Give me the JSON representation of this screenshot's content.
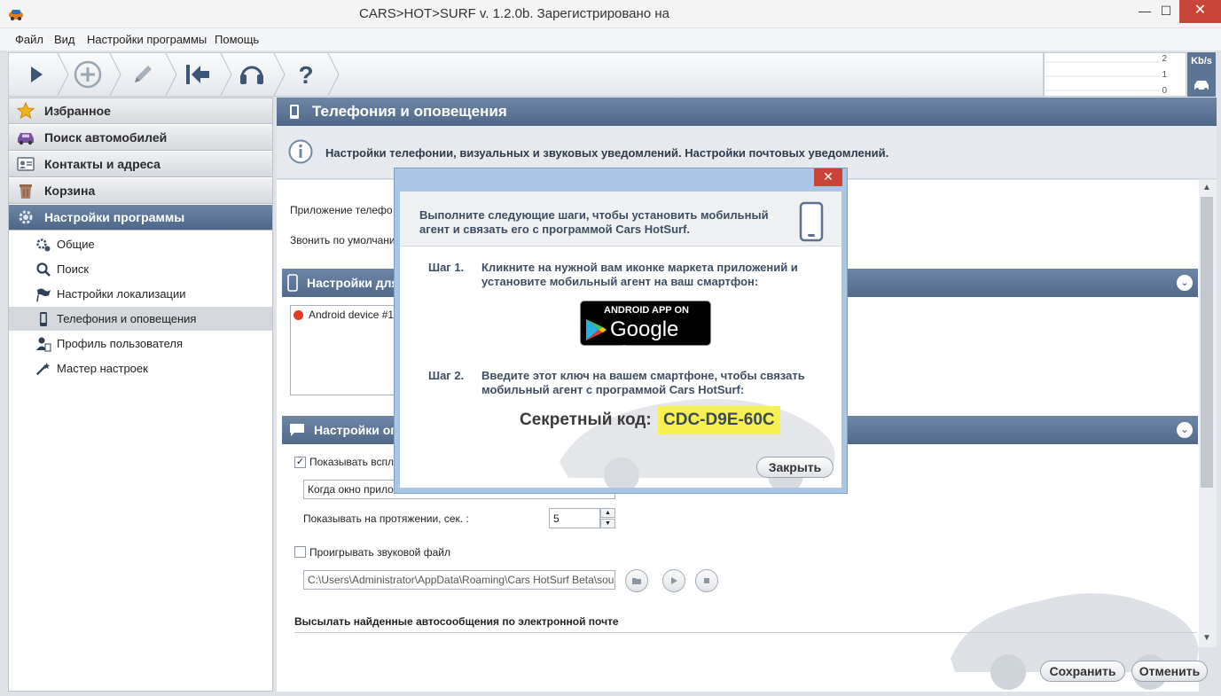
{
  "window": {
    "title": "CARS>HOT>SURF v. 1.2.0b. Зарегистрировано на",
    "minimize": "—",
    "maximize": "☐",
    "close": "✕"
  },
  "menu": [
    "Файл",
    "Вид",
    "Настройки программы",
    "Помощь"
  ],
  "toolbar": {
    "buttons": [
      "play-icon",
      "add-icon",
      "edit-icon",
      "back-to-start-icon",
      "support-headset-icon",
      "help-icon"
    ],
    "speed_labels": [
      "2",
      "1",
      "0"
    ],
    "speed_unit": "Kb/s"
  },
  "sidebar": {
    "sections": [
      {
        "label": "Избранное",
        "icon": "star-icon"
      },
      {
        "label": "Поиск автомобилей",
        "icon": "car-search-icon"
      },
      {
        "label": "Контакты и адреса",
        "icon": "contacts-icon"
      },
      {
        "label": "Корзина",
        "icon": "trash-icon"
      },
      {
        "label": "Настройки программы",
        "icon": "gear-icon",
        "active": true
      }
    ],
    "sub_items": [
      {
        "label": "Общие",
        "icon": "gears-icon"
      },
      {
        "label": "Поиск",
        "icon": "magnifier-icon"
      },
      {
        "label": "Настройки локализации",
        "icon": "flag-icon"
      },
      {
        "label": "Телефония и оповещения",
        "icon": "phone-icon",
        "active": true
      },
      {
        "label": "Профиль пользователя",
        "icon": "user-profile-icon"
      },
      {
        "label": "Мастер настроек",
        "icon": "magic-wand-icon"
      }
    ]
  },
  "main": {
    "header_title": "Телефония и оповещения",
    "info_text": "Настройки телефонии, визуальных и звуковых уведомлений. Настройки почтовых уведомлений.",
    "phone_app_label": "Приложение телефо",
    "call_default_label": "Звонить по умолчани",
    "group1_title": "Настройки для",
    "device_item": "Android device #1",
    "group2_title": "Настройки опо",
    "show_popup_label": "Показывать вспл",
    "show_popup_checked": true,
    "when_window_value": "Когда окно прило",
    "show_duration_label": "Показывать на протяжении, сек. :",
    "show_duration_value": "5",
    "play_sound_label": "Проигрывать звуковой файл",
    "play_sound_checked": false,
    "sound_path": "C:\\Users\\Administrator\\AppData\\Roaming\\Cars HotSurf Beta\\sou",
    "email_section_title": "Высылать найденные автосообщения по электронной почте",
    "save_button": "Сохранить",
    "cancel_button": "Отменить"
  },
  "dialog": {
    "close_glyph": "✕",
    "intro": "Выполните следующие шаги, чтобы установить мобильный агент и связать его с программой Cars HotSurf.",
    "step1_label": "Шаг 1.",
    "step1_text": "Кликните на нужной вам иконке маркета приложений и установите мобильный агент на ваш смартфон:",
    "store_badge_top": "ANDROID APP ON",
    "store_badge_main": "Google play",
    "step2_label": "Шаг 2.",
    "step2_text": "Введите этот ключ на вашем смартфоне, чтобы связать мобильный агент с программой Cars HotSurf:",
    "secret_label": "Секретный код:",
    "secret_code": "CDC-D9E-60C",
    "close_button": "Закрыть"
  }
}
